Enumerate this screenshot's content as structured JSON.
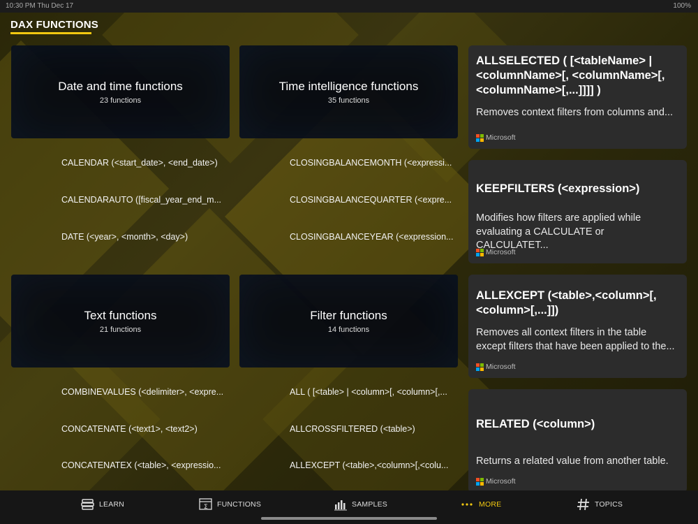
{
  "status_bar": {
    "time": "10:30 PM   Thu Dec 17",
    "battery": "100%"
  },
  "header": {
    "title": "DAX FUNCTIONS"
  },
  "categories": [
    {
      "title": "Date and time functions",
      "count": "23 functions",
      "functions": [
        "CALENDAR (<start_date>, <end_date>)",
        "CALENDARAUTO ([fiscal_year_end_m...",
        "DATE (<year>, <month>, <day>)"
      ]
    },
    {
      "title": "Time intelligence functions",
      "count": "35 functions",
      "functions": [
        "CLOSINGBALANCEMONTH (<expressi...",
        "CLOSINGBALANCEQUARTER (<expre...",
        "CLOSINGBALANCEYEAR (<expression..."
      ]
    },
    {
      "title": "Text functions",
      "count": "21 functions",
      "functions": [
        "COMBINEVALUES (<delimiter>, <expre...",
        "CONCATENATE (<text1>, <text2>)",
        "CONCATENATEX (<table>, <expressio..."
      ]
    },
    {
      "title": "Filter functions",
      "count": "14 functions",
      "functions": [
        "ALL ( [<table> | <column>[, <column>[,...",
        "ALLCROSSFILTERED (<table>)",
        "ALLEXCEPT (<table>,<column>[,<colu..."
      ]
    }
  ],
  "cards": [
    {
      "title": "ALLSELECTED ( [<tableName> | <columnName>[, <columnName>[, <columnName>[,...]]]] )",
      "description": "Removes context filters from columns and...",
      "source": "Microsoft"
    },
    {
      "title": "KEEPFILTERS (<expression>)",
      "description": "Modifies how filters are applied while evaluating a CALCULATE or CALCULATET...",
      "source": "Microsoft"
    },
    {
      "title": "ALLEXCEPT (<table>,<column>[,<column>[,...]])",
      "description": "Removes all context filters in the table except filters that have been applied to the...",
      "source": "Microsoft"
    },
    {
      "title": "RELATED (<column>)",
      "description": "Returns a related value from another table.",
      "source": "Microsoft"
    }
  ],
  "tabs": [
    {
      "label": "LEARN",
      "icon": "book-stack-icon"
    },
    {
      "label": "FUNCTIONS",
      "icon": "function-sigma-icon"
    },
    {
      "label": "SAMPLES",
      "icon": "bar-chart-icon"
    },
    {
      "label": "MORE",
      "icon": "ellipsis-icon",
      "active": true
    },
    {
      "label": "TOPICS",
      "icon": "hashtag-icon"
    }
  ],
  "colors": {
    "accent": "#f2c811",
    "card_bg": "#2c2c2c",
    "tile_bg": "#060a12"
  }
}
